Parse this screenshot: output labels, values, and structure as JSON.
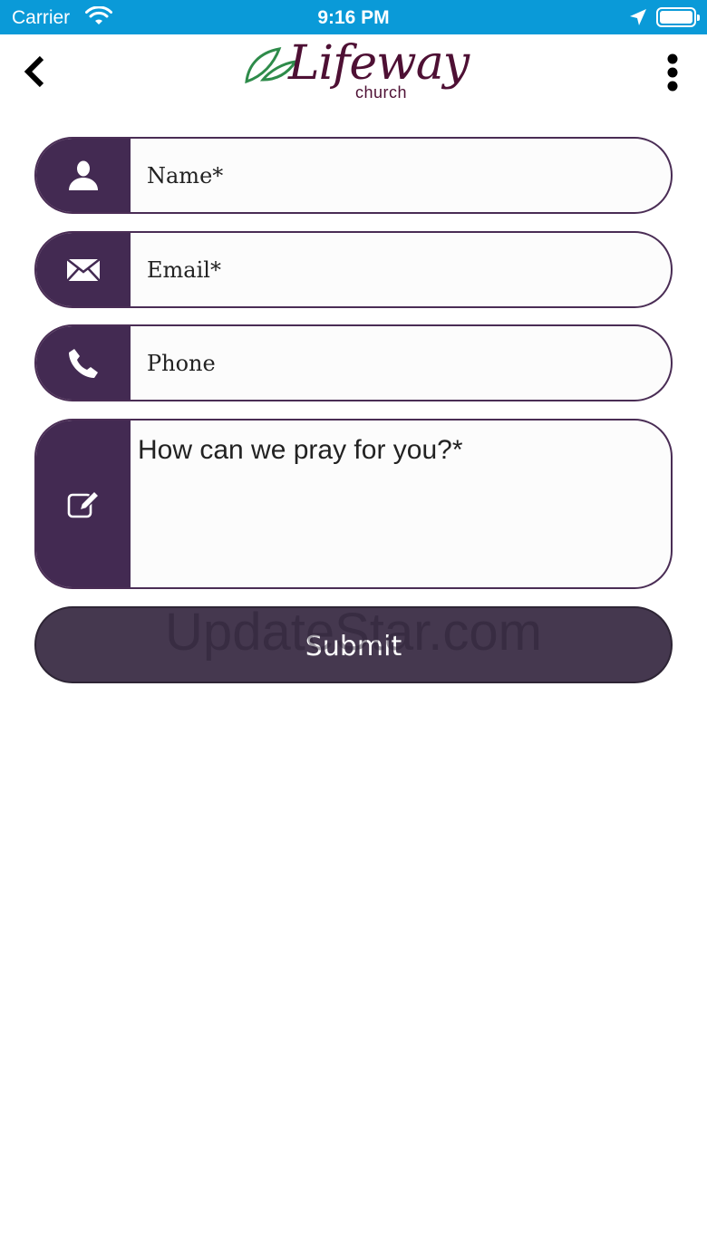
{
  "status_bar": {
    "carrier": "Carrier",
    "time": "9:16 PM"
  },
  "header": {
    "logo_word": "Lifeway",
    "logo_sub": "church"
  },
  "form": {
    "name_placeholder": "Name*",
    "email_placeholder": "Email*",
    "phone_placeholder": "Phone",
    "prayer_placeholder": "How can we pray for you?*",
    "submit_label": "Submit"
  },
  "watermark": "UpdateStar.com",
  "colors": {
    "status_bar": "#0a9ad8",
    "icon_cell": "#432a52",
    "submit": "#45384f",
    "logo": "#4e1034",
    "leaf": "#2e8b4a"
  },
  "icons": {
    "back": "chevron-left-icon",
    "more": "more-vertical-icon",
    "name": "user-icon",
    "email": "envelope-icon",
    "phone": "phone-icon",
    "message": "edit-icon"
  }
}
